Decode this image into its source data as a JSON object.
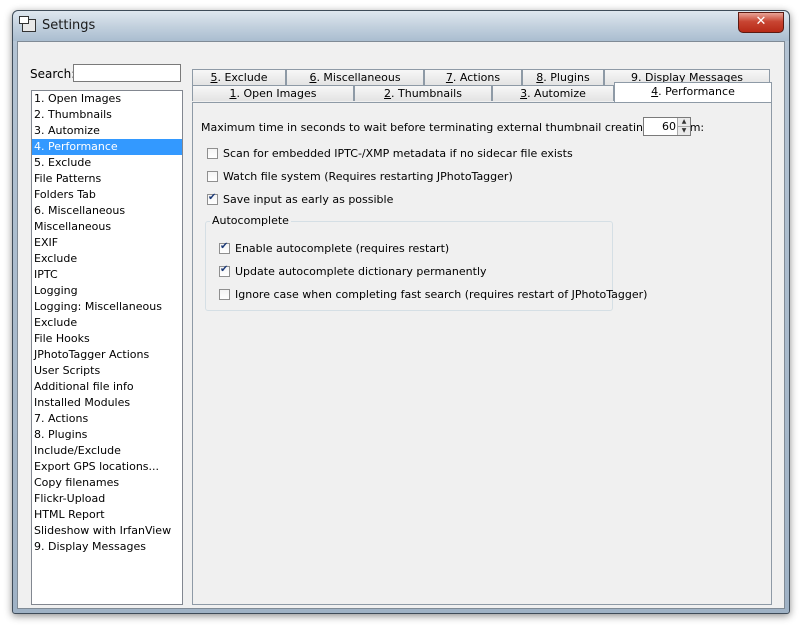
{
  "window": {
    "title": "Settings"
  },
  "search": {
    "label": "Search:",
    "value": ""
  },
  "list": {
    "selected_index": 3,
    "items": [
      "1. Open Images",
      "2. Thumbnails",
      "3. Automize",
      "4. Performance",
      "5. Exclude",
      "File Patterns",
      "Folders Tab",
      "6. Miscellaneous",
      "Miscellaneous",
      "EXIF",
      "Exclude",
      "IPTC",
      "Logging",
      "Logging: Miscellaneous",
      "Exclude",
      "File Hooks",
      "JPhotoTagger Actions",
      "User Scripts",
      "Additional file info",
      "Installed Modules",
      "7. Actions",
      "8. Plugins",
      "Include/Exclude",
      "Export GPS locations...",
      "Copy filenames",
      "Flickr-Upload",
      "HTML Report",
      "Slideshow with IrfanView",
      "9. Display Messages"
    ]
  },
  "tabs": {
    "row1": [
      {
        "num": "5",
        "label": ". Exclude"
      },
      {
        "num": "6",
        "label": ". Miscellaneous"
      },
      {
        "num": "7",
        "label": ". Actions"
      },
      {
        "num": "8",
        "label": ". Plugins"
      },
      {
        "num": "9",
        "label": ". Display Messages"
      }
    ],
    "row2": [
      {
        "num": "1",
        "label": ". Open Images"
      },
      {
        "num": "2",
        "label": ". Thumbnails"
      },
      {
        "num": "3",
        "label": ". Automize"
      },
      {
        "num": "4",
        "label": ". Performance"
      }
    ]
  },
  "performance": {
    "max_time_label": "Maximum time in seconds to wait before terminating external thumbnail creating program:",
    "max_time_value": "60",
    "options": [
      {
        "label": "Scan for embedded IPTC-/XMP metadata if no sidecar file exists",
        "checked": false
      },
      {
        "label": "Watch file system (Requires restarting JPhotoTagger)",
        "checked": false
      },
      {
        "label": "Save input as early as possible",
        "checked": true
      }
    ],
    "autocomplete": {
      "title": "Autocomplete",
      "options": [
        {
          "label": "Enable autocomplete (requires restart)",
          "checked": true
        },
        {
          "label": "Update autocomplete dictionary permanently",
          "checked": true
        },
        {
          "label": "Ignore case when completing fast search (requires restart of JPhotoTagger)",
          "checked": false
        }
      ]
    }
  }
}
